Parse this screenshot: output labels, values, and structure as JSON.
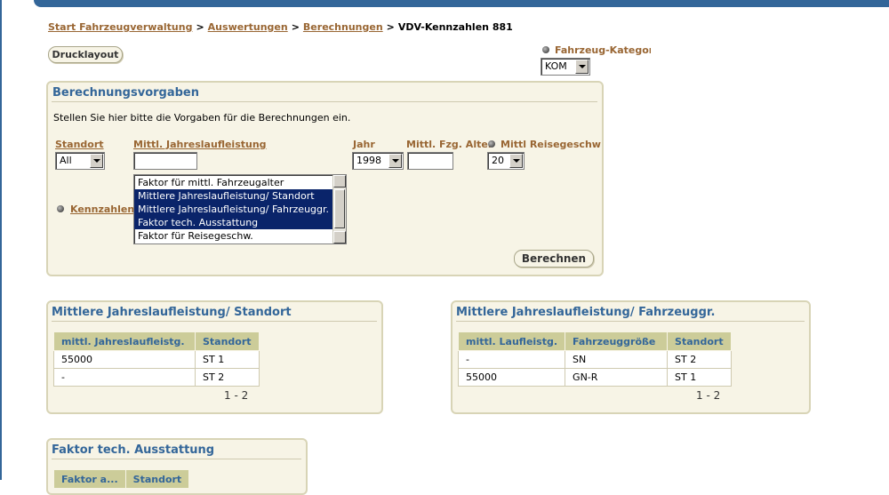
{
  "breadcrumb": {
    "items": [
      "Start Fahrzeugverwaltung",
      "Auswertungen",
      "Berechnungen"
    ],
    "separator": ">",
    "current": "VDV-Kennzahlen 881"
  },
  "buttons": {
    "print_layout": "Drucklayout",
    "calculate": "Berechnen"
  },
  "vehicle_category": {
    "label": "Fahrzeug-Kategorie",
    "value": "KOM"
  },
  "form": {
    "title": "Berechnungsvorgaben",
    "instruction": "Stellen Sie hier bitte die Vorgaben für die Berechnungen ein.",
    "standort": {
      "label": "Standort",
      "value": "All"
    },
    "jahreslaufleistung": {
      "label": "Mittl. Jahreslaufleistung",
      "value": ""
    },
    "jahr": {
      "label": "Jahr",
      "value": "1998"
    },
    "fzg_alter": {
      "label": "Mittl. Fzg. Alter",
      "value": ""
    },
    "reisegeschw": {
      "label": "Mittl Reisegeschw",
      "value": "20"
    },
    "kennzahlen": {
      "label": "Kennzahlen",
      "options": [
        {
          "text": "Faktor für mittl. Fahrzeugalter",
          "selected": false
        },
        {
          "text": "Mittlere Jahreslaufleistung/ Standort",
          "selected": true
        },
        {
          "text": "Mittlere Jahreslaufleistung/ Fahrzeuggr.",
          "selected": true
        },
        {
          "text": "Faktor tech. Ausstattung",
          "selected": true
        },
        {
          "text": "Faktor für Reisegeschw.",
          "selected": false
        }
      ]
    }
  },
  "result_standort": {
    "title": "Mittlere Jahreslaufleistung/ Standort",
    "columns": [
      "mittl. Jahreslaufleistg.",
      "Standort"
    ],
    "rows": [
      [
        "55000",
        "ST 1"
      ],
      [
        "-",
        "ST 2"
      ]
    ],
    "pager": "1 - 2"
  },
  "result_fahrzeuggr": {
    "title": "Mittlere Jahreslaufleistung/ Fahrzeuggr.",
    "columns": [
      "mittl. Laufleistg.",
      "Fahrzeuggröße",
      "Standort"
    ],
    "rows": [
      [
        "-",
        "SN",
        "ST 2"
      ],
      [
        "55000",
        "GN-R",
        "ST 1"
      ]
    ],
    "pager": "1 - 2"
  },
  "result_ausstattung": {
    "title": "Faktor tech. Ausstattung",
    "columns": [
      "Faktor a...",
      "Standort"
    ]
  },
  "colors": {
    "accent": "#336699",
    "link": "#996633",
    "panel_bg": "#f7f4e6",
    "header_bg": "#cccc99",
    "selection": "#0a246a"
  }
}
